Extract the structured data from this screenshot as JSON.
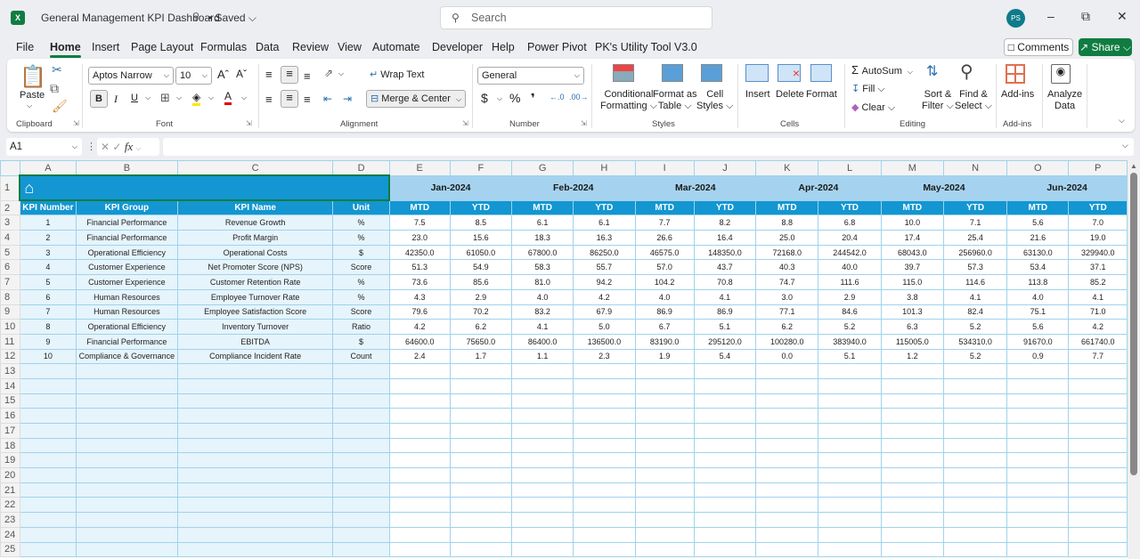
{
  "titlebar": {
    "app_icon": "excel-icon",
    "title": "General Management KPI Dashboard",
    "status": "• Saved ⌵",
    "search_placeholder": "Search",
    "avatar_initials": "PS",
    "minimize": "–",
    "restore": "⧉",
    "close": "✕"
  },
  "menu": {
    "items": [
      "File",
      "Home",
      "Insert",
      "Page Layout",
      "Formulas",
      "Data",
      "Review",
      "View",
      "Automate",
      "Developer",
      "Help",
      "Power Pivot",
      "PK's Utility Tool V3.0"
    ],
    "active": "Home",
    "comments_label": "Comments",
    "share_label": "Share ⌵"
  },
  "ribbon": {
    "clipboard": {
      "label": "Clipboard",
      "paste": "Paste"
    },
    "font": {
      "label": "Font",
      "font_name": "Aptos Narrow",
      "font_size": "10",
      "bold": "B",
      "italic": "I",
      "underline": "U"
    },
    "alignment": {
      "label": "Alignment",
      "wrap_text": "Wrap Text",
      "merge_center": "Merge & Center"
    },
    "number": {
      "label": "Number",
      "format": "General",
      "currency": "$",
      "percent": "%",
      "comma": "❜"
    },
    "styles": {
      "label": "Styles",
      "conditional_formatting": [
        "Conditional",
        "Formatting ⌵"
      ],
      "format_as_table": [
        "Format as",
        "Table ⌵"
      ],
      "cell_styles": [
        "Cell",
        "Styles ⌵"
      ]
    },
    "cells": {
      "label": "Cells",
      "insert": "Insert",
      "delete": "Delete",
      "format": "Format"
    },
    "editing": {
      "label": "Editing",
      "autosum": "AutoSum",
      "fill": "Fill ⌵",
      "clear": "Clear ⌵",
      "sort_filter": [
        "Sort &",
        "Filter ⌵"
      ],
      "find_select": [
        "Find &",
        "Select ⌵"
      ]
    },
    "addins": {
      "label": "Add-ins",
      "addins": "Add-ins",
      "analyze_data": [
        "Analyze",
        "Data"
      ]
    }
  },
  "formula_bar": {
    "name_box": "A1",
    "fx": "fx",
    "value": ""
  },
  "sheet": {
    "columns": [
      "A",
      "B",
      "C",
      "D",
      "E",
      "F",
      "G",
      "H",
      "I",
      "J",
      "K",
      "L",
      "M",
      "N",
      "O",
      "P"
    ],
    "months": [
      "Jan-2024",
      "Feb-2024",
      "Mar-2024",
      "Apr-2024",
      "May-2024",
      "Jun-2024"
    ],
    "headers": [
      "KPI Number",
      "KPI Group",
      "KPI Name",
      "Unit"
    ],
    "sub_headers": [
      "MTD",
      "YTD"
    ],
    "rows": [
      {
        "num": "1",
        "group": "Financial Performance",
        "name": "Revenue Growth",
        "unit": "%",
        "values": [
          "7.5",
          "8.5",
          "6.1",
          "6.1",
          "7.7",
          "8.2",
          "8.8",
          "6.8",
          "10.0",
          "7.1",
          "5.6",
          "7.0"
        ]
      },
      {
        "num": "2",
        "group": "Financial Performance",
        "name": "Profit Margin",
        "unit": "%",
        "values": [
          "23.0",
          "15.6",
          "18.3",
          "16.3",
          "26.6",
          "16.4",
          "25.0",
          "20.4",
          "17.4",
          "25.4",
          "21.6",
          "19.0"
        ]
      },
      {
        "num": "3",
        "group": "Operational Efficiency",
        "name": "Operational Costs",
        "unit": "$",
        "values": [
          "42350.0",
          "61050.0",
          "67800.0",
          "86250.0",
          "46575.0",
          "148350.0",
          "72168.0",
          "244542.0",
          "68043.0",
          "256960.0",
          "63130.0",
          "329940.0"
        ]
      },
      {
        "num": "4",
        "group": "Customer Experience",
        "name": "Net Promoter Score (NPS)",
        "unit": "Score",
        "values": [
          "51.3",
          "54.9",
          "58.3",
          "55.7",
          "57.0",
          "43.7",
          "40.3",
          "40.0",
          "39.7",
          "57.3",
          "53.4",
          "37.1"
        ]
      },
      {
        "num": "5",
        "group": "Customer Experience",
        "name": "Customer Retention Rate",
        "unit": "%",
        "values": [
          "73.6",
          "85.6",
          "81.0",
          "94.2",
          "104.2",
          "70.8",
          "74.7",
          "111.6",
          "115.0",
          "114.6",
          "113.8",
          "85.2"
        ]
      },
      {
        "num": "6",
        "group": "Human Resources",
        "name": "Employee Turnover Rate",
        "unit": "%",
        "values": [
          "4.3",
          "2.9",
          "4.0",
          "4.2",
          "4.0",
          "4.1",
          "3.0",
          "2.9",
          "3.8",
          "4.1",
          "4.0",
          "4.1"
        ]
      },
      {
        "num": "7",
        "group": "Human Resources",
        "name": "Employee Satisfaction Score",
        "unit": "Score",
        "values": [
          "79.6",
          "70.2",
          "83.2",
          "67.9",
          "86.9",
          "86.9",
          "77.1",
          "84.6",
          "101.3",
          "82.4",
          "75.1",
          "71.0"
        ]
      },
      {
        "num": "8",
        "group": "Operational Efficiency",
        "name": "Inventory Turnover",
        "unit": "Ratio",
        "values": [
          "4.2",
          "6.2",
          "4.1",
          "5.0",
          "6.7",
          "5.1",
          "6.2",
          "5.2",
          "6.3",
          "5.2",
          "5.6",
          "4.2"
        ]
      },
      {
        "num": "9",
        "group": "Financial Performance",
        "name": "EBITDA",
        "unit": "$",
        "values": [
          "64600.0",
          "75650.0",
          "86400.0",
          "136500.0",
          "83190.0",
          "295120.0",
          "100280.0",
          "383940.0",
          "115005.0",
          "534310.0",
          "91670.0",
          "661740.0"
        ]
      },
      {
        "num": "10",
        "group": "Compliance & Governance",
        "name": "Compliance Incident Rate",
        "unit": "Count",
        "values": [
          "2.4",
          "1.7",
          "1.1",
          "2.3",
          "1.9",
          "5.4",
          "0.0",
          "5.1",
          "1.2",
          "5.2",
          "0.9",
          "7.7"
        ]
      }
    ],
    "empty_row_numbers": [
      "13",
      "14",
      "15",
      "16",
      "17",
      "18",
      "19",
      "20",
      "21",
      "22",
      "23",
      "24",
      "25"
    ],
    "colors": {
      "header_blue": "#1396d1",
      "month_blue": "#a5d3ef",
      "light_fill": "#e6f4fb",
      "grid_line": "#9fd3ec"
    }
  }
}
